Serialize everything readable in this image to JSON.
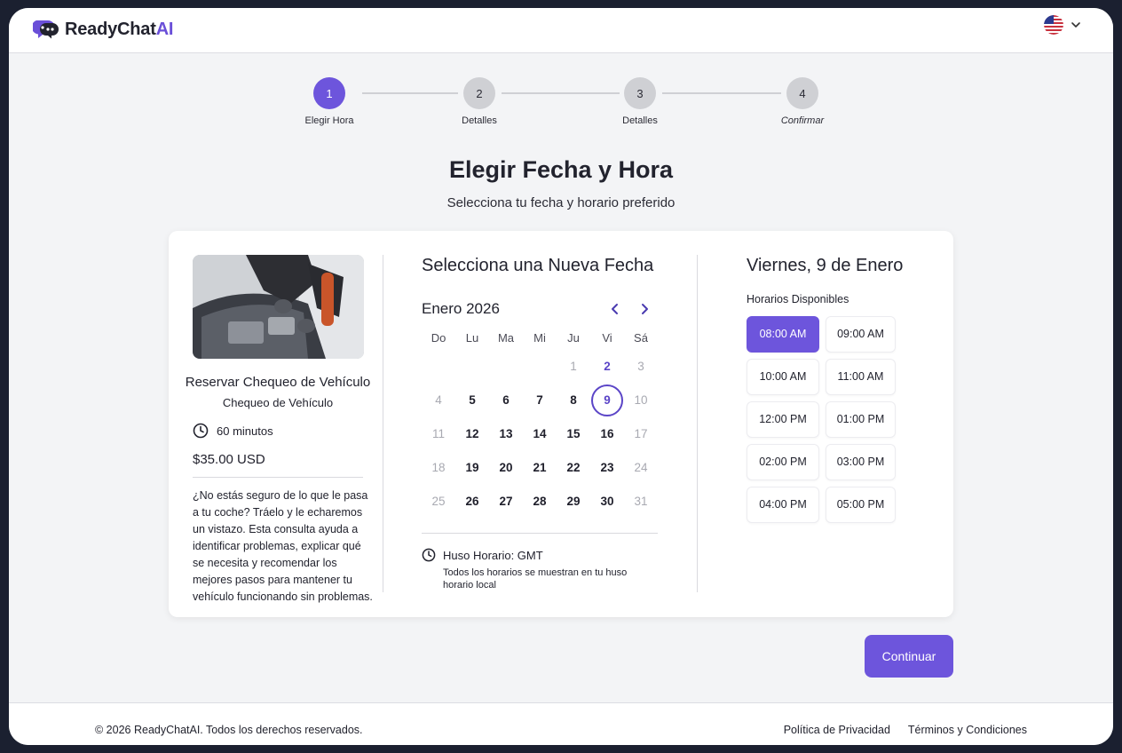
{
  "header": {
    "logo_text": "ReadyChat",
    "logo_accent": "AI",
    "language_icon": "us-flag-icon"
  },
  "stepper": {
    "steps": [
      {
        "number": "1",
        "label": "Elegir Hora",
        "state": "active"
      },
      {
        "number": "2",
        "label": "Detalles",
        "state": "pending"
      },
      {
        "number": "3",
        "label": "Detalles",
        "state": "pending"
      },
      {
        "number": "4",
        "label": "Confirmar",
        "state": "pending"
      }
    ]
  },
  "page": {
    "title": "Elegir Fecha y Hora",
    "subtitle": "Selecciona tu fecha y horario preferido"
  },
  "service": {
    "title": "Reservar Chequeo de Vehículo",
    "subtitle": "Chequeo de Vehículo",
    "duration": "60 minutos",
    "price": "$35.00 USD",
    "description": "¿No estás seguro de lo que le pasa a tu coche? Tráelo y le echaremos un vistazo. Esta consulta ayuda a identificar problemas, explicar qué se necesita y recomendar los mejores pasos para mantener tu vehículo funcionando sin problemas."
  },
  "calendar": {
    "heading": "Selecciona una Nueva Fecha",
    "month_label": "Enero 2026",
    "weekdays": [
      "Do",
      "Lu",
      "Ma",
      "Mi",
      "Ju",
      "Vi",
      "Sá"
    ],
    "weeks": [
      [
        "",
        "",
        "",
        "",
        "1",
        "2",
        "3"
      ],
      [
        "4",
        "5",
        "6",
        "7",
        "8",
        "9",
        "10"
      ],
      [
        "11",
        "12",
        "13",
        "14",
        "15",
        "16",
        "17"
      ],
      [
        "18",
        "19",
        "20",
        "21",
        "22",
        "23",
        "24"
      ],
      [
        "25",
        "26",
        "27",
        "28",
        "29",
        "30",
        "31"
      ]
    ],
    "selected_day": "9",
    "timezone": "Huso Horario: GMT",
    "timezone_note": "Todos los horarios se muestran en tu huso horario local"
  },
  "times": {
    "heading": "Viernes, 9 de Enero",
    "subheading": "Horarios Disponibles",
    "slots": [
      "08:00 AM",
      "09:00 AM",
      "10:00 AM",
      "11:00 AM",
      "12:00 PM",
      "01:00 PM",
      "02:00 PM",
      "03:00 PM",
      "04:00 PM",
      "05:00 PM"
    ],
    "selected": "08:00 AM"
  },
  "actions": {
    "continue_label": "Continuar"
  },
  "footer": {
    "copyright": "© 2026 ReadyChatAI. Todos los derechos reservados.",
    "privacy": "Política de Privacidad",
    "terms": "Términos y Condiciones"
  },
  "colors": {
    "accent": "#6d55dc",
    "accent_dark": "#5b45c7",
    "muted_day": "#a8a9b1"
  }
}
